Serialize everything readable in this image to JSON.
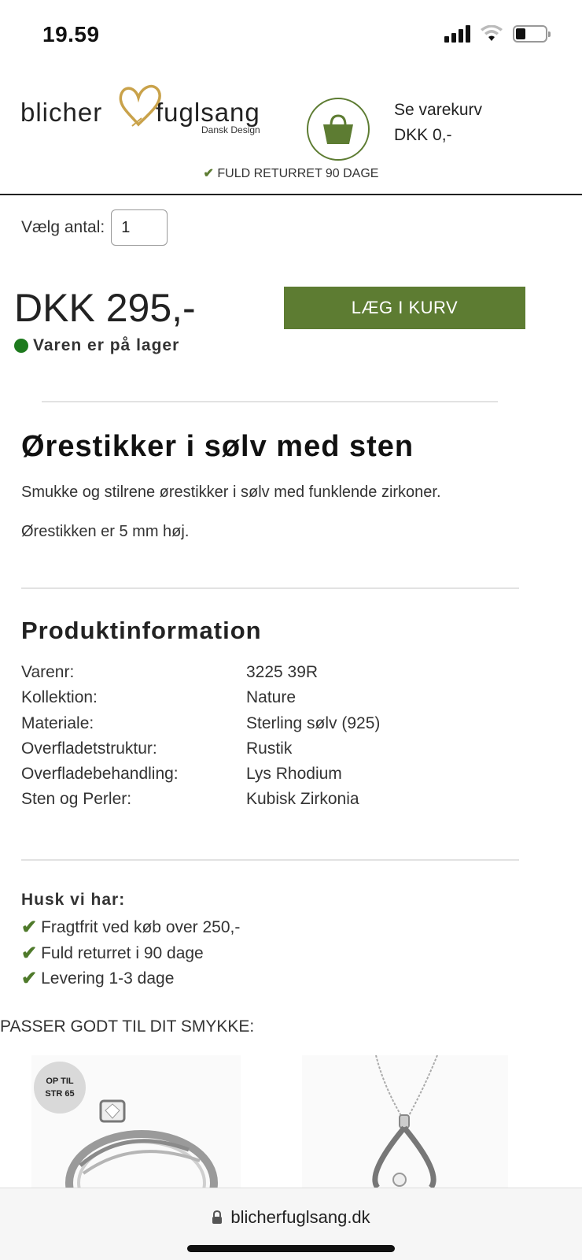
{
  "status_bar": {
    "time": "19.59"
  },
  "header": {
    "logo": {
      "left": "blicher",
      "right": "fuglsang",
      "sub": "Dansk Design"
    },
    "cart": {
      "label": "Se varekurv",
      "amount": "DKK 0,-"
    },
    "return_banner": "FULD RETURRET 90 DAGE"
  },
  "product": {
    "quantity_label": "Vælg antal:",
    "quantity_value": "1",
    "price": "DKK 295,-",
    "buy_label": "LÆG I KURV",
    "stock": "Varen er på lager",
    "title": "Ørestikker i sølv med sten",
    "description": [
      "Smukke og stilrene ørestikker i sølv med funklende zirkoner.",
      "Ørestikken er 5 mm høj."
    ]
  },
  "product_info": {
    "title": "Produktinformation",
    "rows": [
      {
        "key": "Varenr:",
        "value": "3225 39R"
      },
      {
        "key": "Kollektion:",
        "value": "Nature"
      },
      {
        "key": "Materiale:",
        "value": "Sterling sølv (925)"
      },
      {
        "key": "Overfladetstruktur:",
        "value": "Rustik"
      },
      {
        "key": "Overfladebehandling:",
        "value": "Lys Rhodium"
      },
      {
        "key": "Sten og Perler:",
        "value": "Kubisk Zirkonia"
      }
    ]
  },
  "remember": {
    "title": "Husk vi har:",
    "items": [
      "Fragtfrit ved køb over 250,-",
      "Fuld returret i 90 dage",
      "Levering 1-3 dage"
    ]
  },
  "related": {
    "title": "PASSER GODT TIL DIT SMYKKE:",
    "badge_line1": "OP TIL",
    "badge_line2": "STR 65"
  },
  "browser": {
    "url": "blicherfuglsang.dk"
  },
  "colors": {
    "accent_green": "#5d7c32",
    "stock_green": "#1e7a1e",
    "logo_gold": "#c9a24a"
  },
  "icons": {
    "cart": "shopping-bag-icon",
    "check": "check-icon",
    "lock": "lock-icon"
  }
}
